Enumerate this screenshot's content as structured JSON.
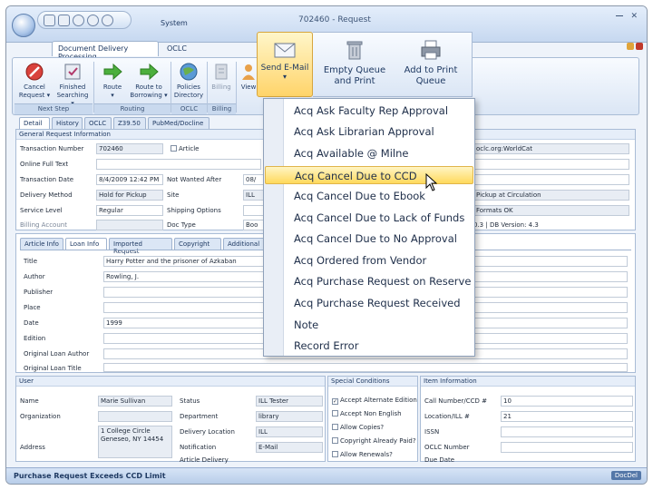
{
  "window": {
    "title": "702460 - Request",
    "system_tab": "System"
  },
  "ribbon_tabs": [
    "Document Delivery Processing",
    "OCLC"
  ],
  "ribbon_buttons": [
    {
      "id": "cancel",
      "label": "Cancel Request",
      "arrow": "▾"
    },
    {
      "id": "finished",
      "label": "Finished Searching",
      "arrow": "▾"
    },
    {
      "id": "route",
      "label": "Route",
      "arrow": "▾"
    },
    {
      "id": "route-borrowing",
      "label": "Route to Borrowing",
      "arrow": "▾"
    },
    {
      "id": "policies",
      "label": "Policies Directory",
      "arrow": ""
    },
    {
      "id": "billing",
      "label": "Billing",
      "arrow": ""
    },
    {
      "id": "view",
      "label": "View",
      "arrow": ""
    }
  ],
  "ribbon_groups": [
    "Next Step",
    "Routing",
    "OCLC",
    "Billing"
  ],
  "send_email": {
    "label": "Send E-Mail",
    "arrow": "▾"
  },
  "big_buttons": [
    {
      "id": "empty-queue",
      "label": "Empty Queue and Print"
    },
    {
      "id": "add-to-print",
      "label": "Add to Print Queue"
    }
  ],
  "subtabs": [
    "Detail",
    "History",
    "OCLC",
    "Z39.50",
    "PubMed/Docline"
  ],
  "general_info": {
    "header": "General Request Information",
    "fields": [
      {
        "label": "Transaction Number",
        "value": "702460"
      },
      {
        "label": "Online Full Text",
        "value": ""
      },
      {
        "label": "Transaction Date",
        "value": "8/4/2009 12:42 PM"
      },
      {
        "label": "Delivery Method",
        "value": "Hold for Pickup"
      },
      {
        "label": "Service Level",
        "value": "Regular"
      },
      {
        "label": "Billing Account",
        "value": ""
      }
    ],
    "rush_label": "Article",
    "mid_fields": [
      {
        "label": "Not Wanted After",
        "value": "08/"
      },
      {
        "label": "Site",
        "value": "ILL"
      },
      {
        "label": "Shipping Options",
        "value": ""
      },
      {
        "label": "Doc Type",
        "value": "Boo"
      }
    ],
    "right_values": [
      "oclc.org:WorldCat",
      "",
      "",
      "Pickup at Circulation",
      "Formats OK",
      "0.3 | DB Version: 4.3"
    ]
  },
  "loan_tabs": [
    "Article Info",
    "Loan Info",
    "Imported Request",
    "Copyright",
    "Additional"
  ],
  "loan_fields": [
    {
      "label": "Title",
      "value": "Harry Potter and the prisoner of Azkaban"
    },
    {
      "label": "Author",
      "value": "Rowling, J."
    },
    {
      "label": "Publisher",
      "value": ""
    },
    {
      "label": "Place",
      "value": ""
    },
    {
      "label": "Date",
      "value": "1999"
    },
    {
      "label": "Edition",
      "value": ""
    },
    {
      "label": "Original Loan Author",
      "value": ""
    },
    {
      "label": "Original Loan Title",
      "value": ""
    }
  ],
  "user": {
    "header": "User",
    "name_label": "Name",
    "name": "Marie Sullivan",
    "org_label": "Organization",
    "address_label": "Address",
    "address": "1 College Circle Geneseo, NY 14454",
    "status_label": "Status",
    "status": "ILL Tester",
    "dept_label": "Department",
    "dept": "library",
    "delivery_label": "Delivery Location",
    "delivery": "ILL",
    "notification_label": "Notification",
    "notification": "E-Mail",
    "article_label": "Article Delivery"
  },
  "special_conditions": {
    "header": "Special Conditions",
    "items": [
      {
        "label": "Accept Alternate Edition",
        "checked": "✓"
      },
      {
        "label": "Accept Non English",
        "checked": ""
      },
      {
        "label": "Allow Copies?",
        "checked": ""
      },
      {
        "label": "Copyright Already Paid?",
        "checked": ""
      },
      {
        "label": "Allow Renewals?",
        "checked": ""
      }
    ]
  },
  "item_info": {
    "header": "Item Information",
    "fields": [
      {
        "label": "Call Number/CCD #",
        "value": "10"
      },
      {
        "label": "Location/ILL #",
        "value": "21"
      },
      {
        "label": "ISSN",
        "value": ""
      },
      {
        "label": "OCLC Number",
        "value": ""
      },
      {
        "label": "Due Date",
        "value": ""
      }
    ]
  },
  "email_menu": {
    "items": [
      "Acq Ask Faculty Rep Approval",
      "Acq Ask Librarian Approval",
      "Acq Available @ Milne",
      "Acq Cancel Due to CCD",
      "Acq Cancel Due to Ebook",
      "Acq Cancel Due to Lack of Funds",
      "Acq Cancel Due to No Approval",
      "Acq Ordered from Vendor",
      "Acq Purchase Request on Reserve",
      "Acq Purchase Request Received",
      "Note",
      "Record Error"
    ],
    "highlighted_index": 3
  },
  "status_bar": {
    "text": "Purchase Request Exceeds CCD Limit",
    "right": "DocDel"
  }
}
